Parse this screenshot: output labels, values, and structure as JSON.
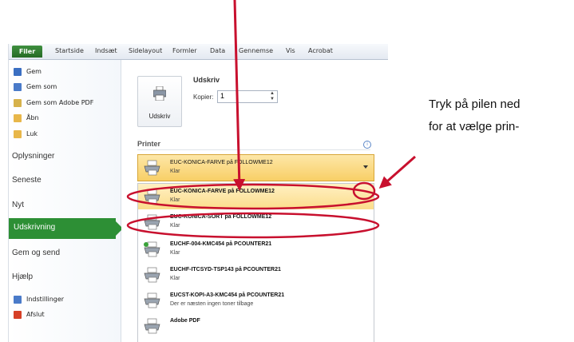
{
  "ribbon": {
    "tabs": [
      "Filer",
      "Startside",
      "Indsæt",
      "Sidelayout",
      "Formler",
      "Data",
      "Gennemse",
      "Vis",
      "Acrobat"
    ]
  },
  "menu": {
    "items": [
      {
        "label": "Gem",
        "icon": "save-icon",
        "color": "#3b6fc2"
      },
      {
        "label": "Gem som",
        "icon": "save-as-icon",
        "color": "#4a7bc9"
      },
      {
        "label": "Gem som Adobe PDF",
        "icon": "pdf-icon",
        "color": "#d6b24b"
      },
      {
        "label": "Åbn",
        "icon": "folder-open-icon",
        "color": "#e8b74a"
      },
      {
        "label": "Luk",
        "icon": "folder-close-icon",
        "color": "#e8b74a"
      }
    ],
    "sections": [
      "Oplysninger",
      "Seneste",
      "Nyt",
      "Udskrivning",
      "Gem og send",
      "Hjælp"
    ],
    "selected": "Udskrivning",
    "bottom_items": [
      {
        "label": "Indstillinger",
        "icon": "options-icon",
        "color": "#4a7bc9"
      },
      {
        "label": "Afslut",
        "icon": "exit-icon",
        "color": "#d64027"
      }
    ]
  },
  "print": {
    "button_label": "Udskriv",
    "title": "Udskriv",
    "copies_label": "Kopier:",
    "copies_value": "1",
    "printer_heading": "Printer",
    "selected_printer": {
      "name": "EUC-KONICA-FARVE på FOLLOWME12",
      "status": "Klar"
    },
    "printers": [
      {
        "name": "EUC-KONICA-FARVE på FOLLOWME12",
        "status": "Klar",
        "highlighted": true
      },
      {
        "name": "EUC-KONICA-SORT på FOLLOWME12",
        "status": "Klar",
        "highlighted": false
      },
      {
        "name": "EUCHF-004-KMC454 på PCOUNTER21",
        "status": "Klar",
        "highlighted": false
      },
      {
        "name": "EUCHF-ITCSYD-TSP143 på PCOUNTER21",
        "status": "Klar",
        "highlighted": false
      },
      {
        "name": "EUCST-KOPI-A3-KMC454 på PCOUNTER21",
        "status": "Der er næsten ingen toner tilbage",
        "highlighted": false
      },
      {
        "name": "Adobe PDF",
        "status": "",
        "highlighted": false
      }
    ]
  },
  "annotation": {
    "line1": "Tryk på pilen ned",
    "line2": "for at vælge prin-",
    "color": "#c8102e"
  },
  "colors": {
    "accent": "#2d8f35",
    "highlight": "#f8cf66"
  }
}
